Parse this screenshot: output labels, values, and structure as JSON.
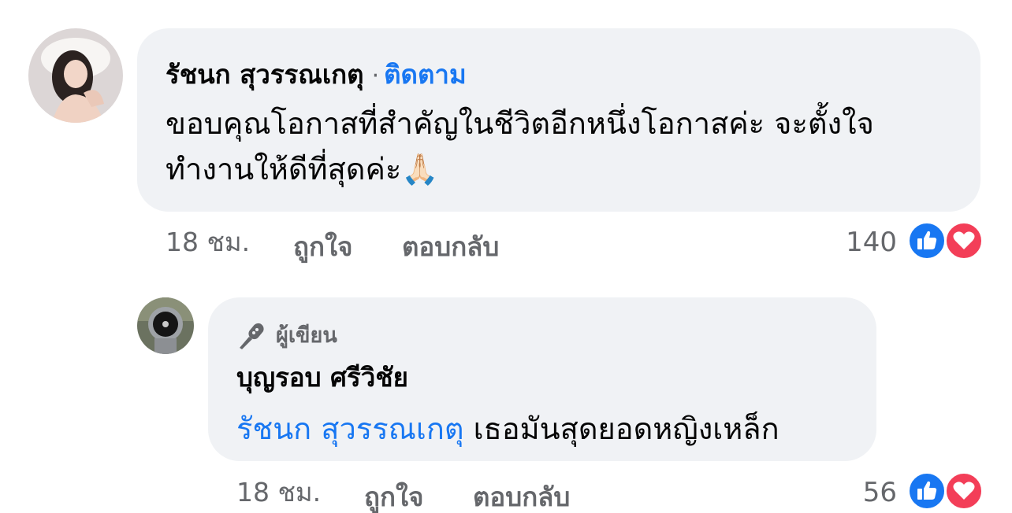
{
  "comment1": {
    "author": "รัชนก สุวรรณเกตุ",
    "separator": "·",
    "follow_label": "ติดตาม",
    "text_line1": "ขอบคุณโอกาสที่สำคัญในชีวิตอีกหนึ่งโอกาสค่ะ จะตั้งใจ",
    "text_line2": "ทำงานให้ดีที่สุดค่ะ🙏🏻",
    "time": "18 ชม.",
    "like_label": "ถูกใจ",
    "reply_label": "ตอบกลับ",
    "reaction_count": "140",
    "reactions": [
      "like-icon",
      "love-icon"
    ]
  },
  "comment2": {
    "badge_label": "ผู้เขียน",
    "badge_icon": "microphone-icon",
    "author": "บุญรอบ ศรีวิชัย",
    "mention": "รัชนก สุวรรณเกตุ",
    "text": " เธอมันสุดยอดหญิงเหล็ก",
    "time": "18 ชม.",
    "like_label": "ถูกใจ",
    "reply_label": "ตอบกลับ",
    "reaction_count": "56",
    "reactions": [
      "like-icon",
      "love-icon"
    ]
  },
  "colors": {
    "bubble": "#f0f2f5",
    "link": "#1877f2",
    "meta": "#65676b",
    "like": "#1877f2",
    "love": "#f33e58"
  }
}
